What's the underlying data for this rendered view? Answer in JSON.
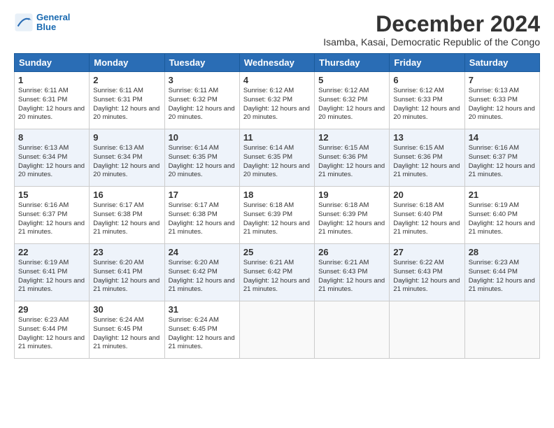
{
  "logo": {
    "line1": "General",
    "line2": "Blue"
  },
  "title": "December 2024",
  "location": "Isamba, Kasai, Democratic Republic of the Congo",
  "headers": [
    "Sunday",
    "Monday",
    "Tuesday",
    "Wednesday",
    "Thursday",
    "Friday",
    "Saturday"
  ],
  "weeks": [
    [
      {
        "day": "1",
        "sunrise": "6:11 AM",
        "sunset": "6:31 PM",
        "daylight": "12 hours and 20 minutes."
      },
      {
        "day": "2",
        "sunrise": "6:11 AM",
        "sunset": "6:31 PM",
        "daylight": "12 hours and 20 minutes."
      },
      {
        "day": "3",
        "sunrise": "6:11 AM",
        "sunset": "6:32 PM",
        "daylight": "12 hours and 20 minutes."
      },
      {
        "day": "4",
        "sunrise": "6:12 AM",
        "sunset": "6:32 PM",
        "daylight": "12 hours and 20 minutes."
      },
      {
        "day": "5",
        "sunrise": "6:12 AM",
        "sunset": "6:32 PM",
        "daylight": "12 hours and 20 minutes."
      },
      {
        "day": "6",
        "sunrise": "6:12 AM",
        "sunset": "6:33 PM",
        "daylight": "12 hours and 20 minutes."
      },
      {
        "day": "7",
        "sunrise": "6:13 AM",
        "sunset": "6:33 PM",
        "daylight": "12 hours and 20 minutes."
      }
    ],
    [
      {
        "day": "8",
        "sunrise": "6:13 AM",
        "sunset": "6:34 PM",
        "daylight": "12 hours and 20 minutes."
      },
      {
        "day": "9",
        "sunrise": "6:13 AM",
        "sunset": "6:34 PM",
        "daylight": "12 hours and 20 minutes."
      },
      {
        "day": "10",
        "sunrise": "6:14 AM",
        "sunset": "6:35 PM",
        "daylight": "12 hours and 20 minutes."
      },
      {
        "day": "11",
        "sunrise": "6:14 AM",
        "sunset": "6:35 PM",
        "daylight": "12 hours and 20 minutes."
      },
      {
        "day": "12",
        "sunrise": "6:15 AM",
        "sunset": "6:36 PM",
        "daylight": "12 hours and 21 minutes."
      },
      {
        "day": "13",
        "sunrise": "6:15 AM",
        "sunset": "6:36 PM",
        "daylight": "12 hours and 21 minutes."
      },
      {
        "day": "14",
        "sunrise": "6:16 AM",
        "sunset": "6:37 PM",
        "daylight": "12 hours and 21 minutes."
      }
    ],
    [
      {
        "day": "15",
        "sunrise": "6:16 AM",
        "sunset": "6:37 PM",
        "daylight": "12 hours and 21 minutes."
      },
      {
        "day": "16",
        "sunrise": "6:17 AM",
        "sunset": "6:38 PM",
        "daylight": "12 hours and 21 minutes."
      },
      {
        "day": "17",
        "sunrise": "6:17 AM",
        "sunset": "6:38 PM",
        "daylight": "12 hours and 21 minutes."
      },
      {
        "day": "18",
        "sunrise": "6:18 AM",
        "sunset": "6:39 PM",
        "daylight": "12 hours and 21 minutes."
      },
      {
        "day": "19",
        "sunrise": "6:18 AM",
        "sunset": "6:39 PM",
        "daylight": "12 hours and 21 minutes."
      },
      {
        "day": "20",
        "sunrise": "6:18 AM",
        "sunset": "6:40 PM",
        "daylight": "12 hours and 21 minutes."
      },
      {
        "day": "21",
        "sunrise": "6:19 AM",
        "sunset": "6:40 PM",
        "daylight": "12 hours and 21 minutes."
      }
    ],
    [
      {
        "day": "22",
        "sunrise": "6:19 AM",
        "sunset": "6:41 PM",
        "daylight": "12 hours and 21 minutes."
      },
      {
        "day": "23",
        "sunrise": "6:20 AM",
        "sunset": "6:41 PM",
        "daylight": "12 hours and 21 minutes."
      },
      {
        "day": "24",
        "sunrise": "6:20 AM",
        "sunset": "6:42 PM",
        "daylight": "12 hours and 21 minutes."
      },
      {
        "day": "25",
        "sunrise": "6:21 AM",
        "sunset": "6:42 PM",
        "daylight": "12 hours and 21 minutes."
      },
      {
        "day": "26",
        "sunrise": "6:21 AM",
        "sunset": "6:43 PM",
        "daylight": "12 hours and 21 minutes."
      },
      {
        "day": "27",
        "sunrise": "6:22 AM",
        "sunset": "6:43 PM",
        "daylight": "12 hours and 21 minutes."
      },
      {
        "day": "28",
        "sunrise": "6:23 AM",
        "sunset": "6:44 PM",
        "daylight": "12 hours and 21 minutes."
      }
    ],
    [
      {
        "day": "29",
        "sunrise": "6:23 AM",
        "sunset": "6:44 PM",
        "daylight": "12 hours and 21 minutes."
      },
      {
        "day": "30",
        "sunrise": "6:24 AM",
        "sunset": "6:45 PM",
        "daylight": "12 hours and 21 minutes."
      },
      {
        "day": "31",
        "sunrise": "6:24 AM",
        "sunset": "6:45 PM",
        "daylight": "12 hours and 21 minutes."
      },
      null,
      null,
      null,
      null
    ]
  ],
  "labels": {
    "sunrise": "Sunrise:",
    "sunset": "Sunset:",
    "daylight": "Daylight:"
  }
}
